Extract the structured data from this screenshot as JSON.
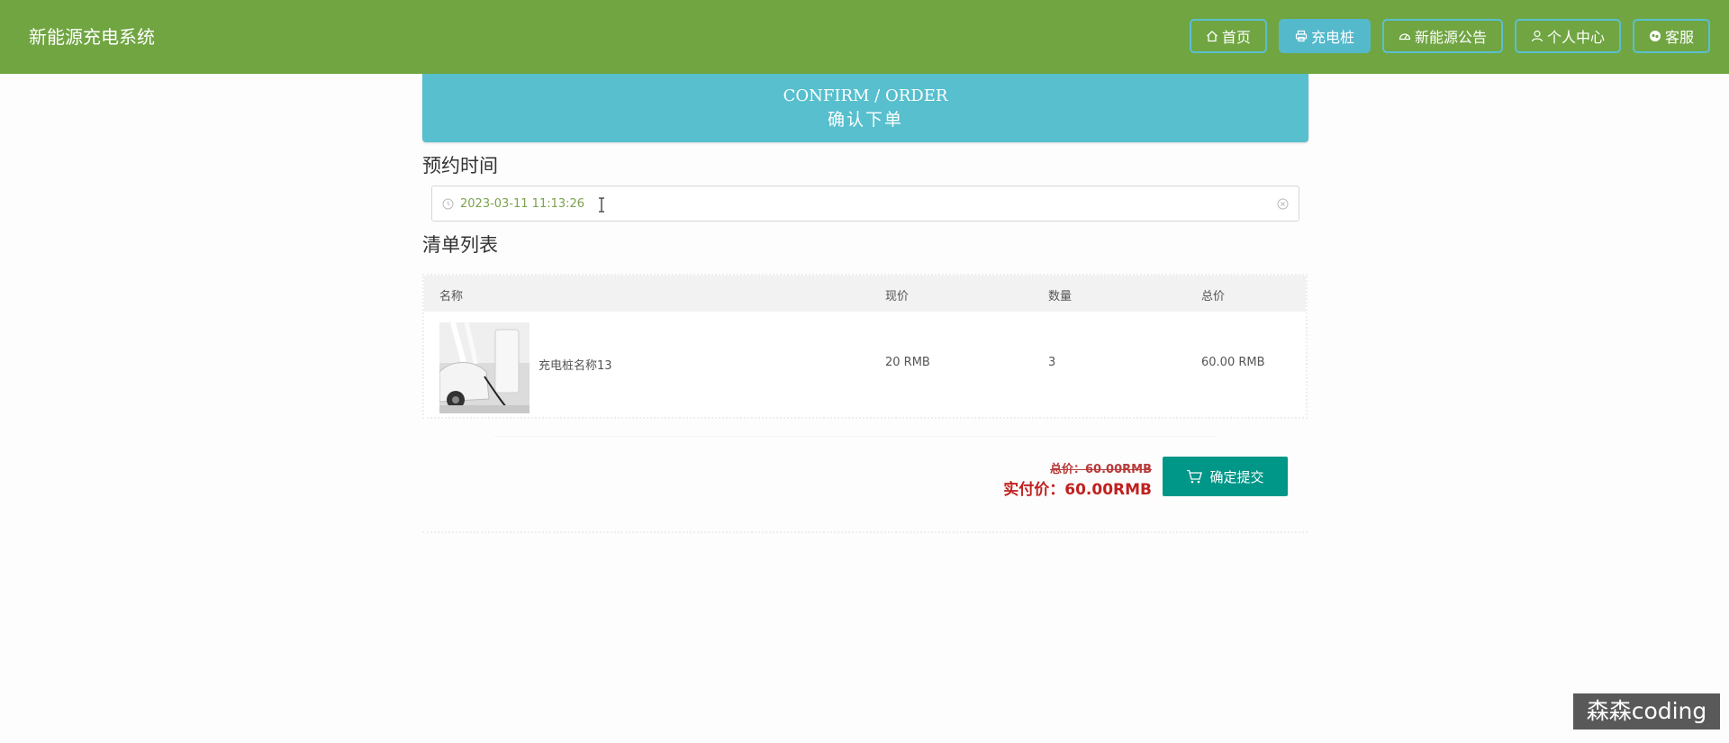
{
  "header": {
    "brand": "新能源充电系统",
    "nav": [
      {
        "label": "首页",
        "icon": "home-icon"
      },
      {
        "label": "充电桩",
        "icon": "printer-icon",
        "active": true
      },
      {
        "label": "新能源公告",
        "icon": "dashboard-icon"
      },
      {
        "label": "个人中心",
        "icon": "user-icon"
      },
      {
        "label": "客服",
        "icon": "chat-icon"
      }
    ],
    "colors": {
      "bar": "#70a542",
      "active": "#55b9cc"
    }
  },
  "banner": {
    "title_en": "CONFIRM / ORDER",
    "title_cn": "确认下单",
    "color": "#57bfcd"
  },
  "booking": {
    "label": "预约时间",
    "datetime_value": "2023-03-11 11:13:26",
    "clock_icon": "clock-icon",
    "clear_icon": "clear-icon"
  },
  "order_list": {
    "label": "清单列表",
    "columns": [
      "名称",
      "现价",
      "数量",
      "总价"
    ],
    "rows": [
      {
        "name": "充电桩名称13",
        "price": "20 RMB",
        "quantity": "3",
        "total": "60.00 RMB"
      }
    ]
  },
  "summary": {
    "total_label": "总价：60.00RMB",
    "actual_label": "实付价：60.00RMB",
    "submit_label": "确定提交",
    "submit_icon": "cart-icon",
    "submit_color": "#009688"
  },
  "watermark": "森森coding"
}
